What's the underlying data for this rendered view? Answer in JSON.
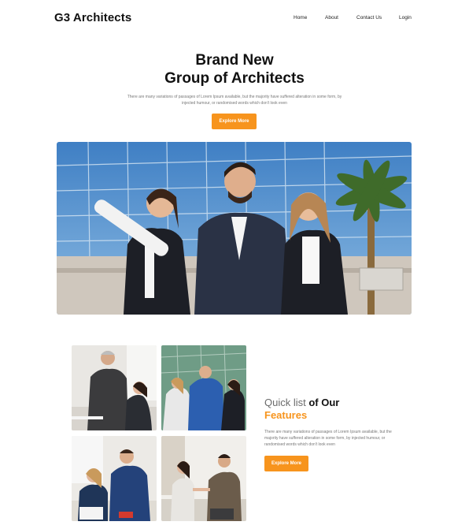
{
  "nav": {
    "brand": "G3 Architects",
    "items": [
      "Home",
      "About",
      "Contact Us",
      "Login"
    ]
  },
  "hero": {
    "title_line1": "Brand New",
    "title_line2": "Group of Architects",
    "description": "There are many variations of passages of Lorem Ipsum available, but the majority have suffered alteration in some form, by injected humour, or randomised words which don't look even",
    "button": "Explore More"
  },
  "features": {
    "title_light": "Quick list",
    "title_dark": "of Our",
    "title_accent": "Features",
    "description": "There are many variations of passages of Lorem Ipsum available, but the majority have suffered alteration in some form, by injected humour, or randomised words which don't look even",
    "button": "Explore More"
  },
  "colors": {
    "accent": "#f7941d",
    "text": "#111111",
    "muted": "#777777"
  }
}
